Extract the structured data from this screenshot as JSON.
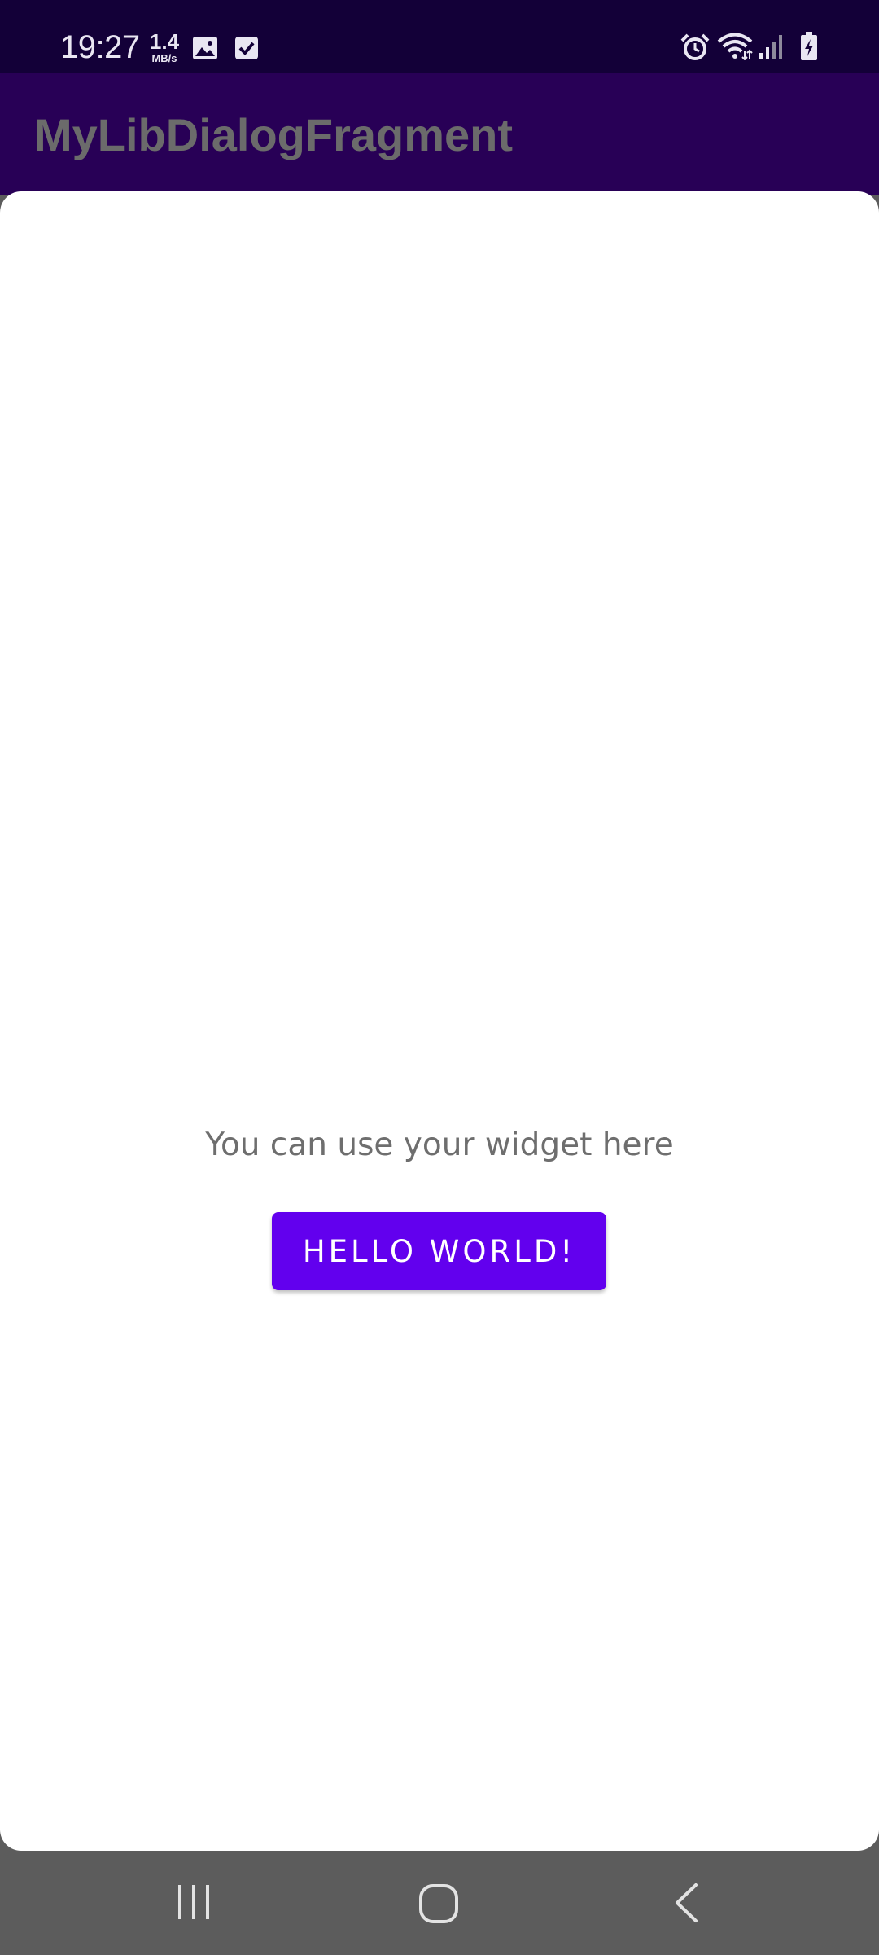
{
  "status_bar": {
    "time": "19:27",
    "net_speed_value": "1.4",
    "net_speed_unit": "MB/s",
    "icons": [
      "gallery-icon",
      "check-icon",
      "alarm-icon",
      "wifi-icon",
      "signal-icon",
      "battery-charging-icon"
    ]
  },
  "app_bar": {
    "title": "MyLibDialogFragment"
  },
  "dialog": {
    "message": "You can use your widget here",
    "button_label": "HELLO WORLD!"
  },
  "nav_bar": {
    "icons": [
      "recents-icon",
      "home-icon",
      "back-icon"
    ]
  },
  "colors": {
    "status_bar_bg": "#130038",
    "app_bar_bg": "#280056",
    "button_bg": "#6200ee",
    "nav_bar_bg": "#5c5c5c"
  }
}
